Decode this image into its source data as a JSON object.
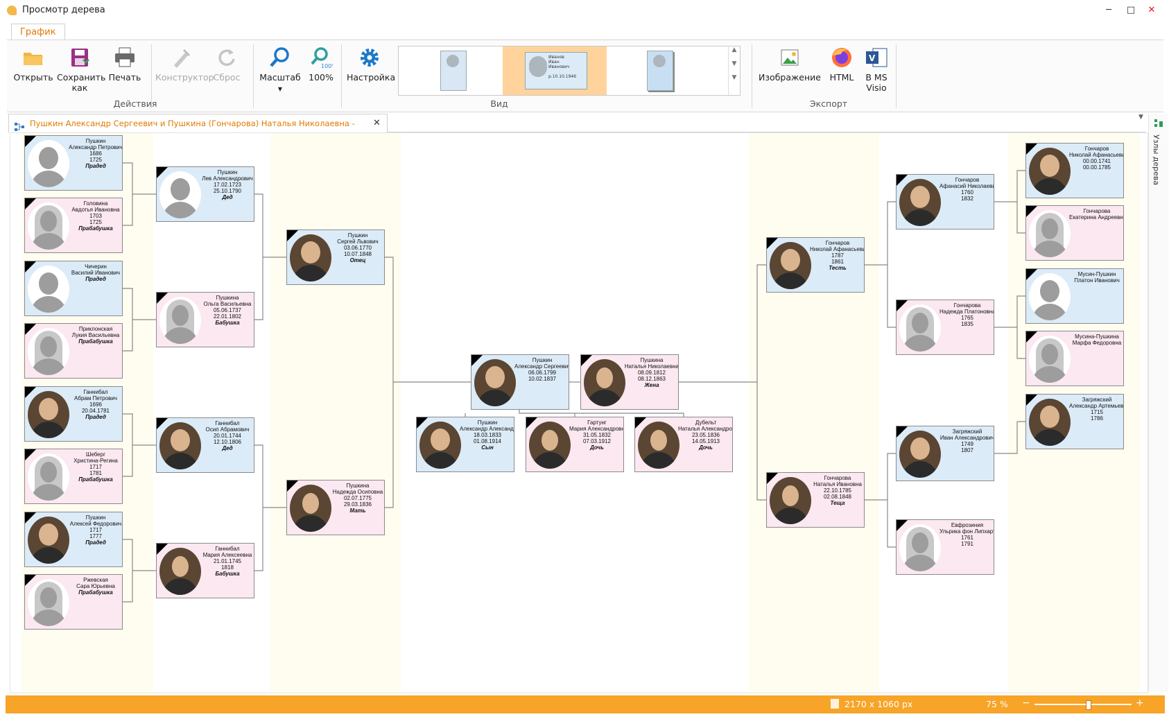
{
  "window": {
    "title": "Просмотр дерева",
    "minimize": "─",
    "maximize": "□",
    "close": "✕",
    "close_color": "#e81123"
  },
  "ribbon_tab": "График",
  "ribbon": {
    "actions": {
      "label": "Действия",
      "open": "Открыть",
      "save_as_1": "Сохранить",
      "save_as_2": "как",
      "print": "Печать",
      "constructor": "Конструктор",
      "reset": "Сброс"
    },
    "view": {
      "label": "Вид",
      "zoom": "Масштаб",
      "zoom100": "100%",
      "settings": "Настройка"
    },
    "export": {
      "label": "Экспорт",
      "image": "Изображение",
      "html": "HTML",
      "visio_1": "В MS",
      "visio_2": "Visio"
    }
  },
  "gallery_sample": {
    "line1": "Иванов",
    "line2": "Иван",
    "line3": "Иванович",
    "line4": "р.10.10.1946"
  },
  "document_tab": {
    "title": "Пушкин Александр Сергеевич и Пушкина (Гончарова) Наталья Николаевна - График \"бабочка\"",
    "close": "✕"
  },
  "side_panel": {
    "label": "Узлы дерева"
  },
  "status": {
    "page_size": "2170 x 1060 px",
    "zoom": "75 %",
    "zoom_fraction": 0.55
  },
  "colors": {
    "male": "#dcebf8",
    "female": "#fbe8f0",
    "accent": "#f7a428",
    "band": "#fffdf0"
  },
  "nodes": [
    {
      "id": "n1",
      "g": "m",
      "lines": [
        "Пушкин",
        "Александр Петрович",
        "1686",
        "1725"
      ],
      "rel": "Прадед"
    },
    {
      "id": "n2",
      "g": "f",
      "lines": [
        "Головина",
        "Авдотья Ивановна",
        "1703",
        "1725"
      ],
      "rel": "Прабабушка"
    },
    {
      "id": "n3",
      "g": "m",
      "lines": [
        "Чичерин",
        "Василий Иванович"
      ],
      "rel": "Прадед"
    },
    {
      "id": "n4",
      "g": "f",
      "lines": [
        "Приклонская",
        "Лукия Васильевна"
      ],
      "rel": "Прабабушка"
    },
    {
      "id": "n5",
      "g": "m",
      "lines": [
        "Ганнибал",
        "Абрам Петрович",
        "1696",
        "20.04.1781"
      ],
      "rel": "Прадед",
      "portrait": true
    },
    {
      "id": "n6",
      "g": "f",
      "lines": [
        "Шеберг",
        "Христина-Регина",
        "1717",
        "1781"
      ],
      "rel": "Прабабушка"
    },
    {
      "id": "n7",
      "g": "m",
      "lines": [
        "Пушкин",
        "Алексей Федорович",
        "1717",
        "1777"
      ],
      "rel": "Прадед",
      "portrait": true
    },
    {
      "id": "n8",
      "g": "f",
      "lines": [
        "Ржевская",
        "Сара Юрьевна"
      ],
      "rel": "Прабабушка"
    },
    {
      "id": "n9",
      "g": "m",
      "lines": [
        "Пушкин",
        "Лев Александрович",
        "17.02.1723",
        "25.10.1790"
      ],
      "rel": "Дед"
    },
    {
      "id": "n10",
      "g": "f",
      "lines": [
        "Пушкина",
        "Ольга Васильевна",
        "05.06.1737",
        "22.01.1802"
      ],
      "rel": "Бабушка"
    },
    {
      "id": "n11",
      "g": "m",
      "lines": [
        "Ганнибал",
        "Осип Абрамович",
        "20.01.1744",
        "12.10.1806"
      ],
      "rel": "Дед",
      "portrait": true
    },
    {
      "id": "n12",
      "g": "f",
      "lines": [
        "Ганнибал",
        "Мария Алексеевна",
        "21.01.1745",
        "1818"
      ],
      "rel": "Бабушка",
      "portrait": true
    },
    {
      "id": "n13",
      "g": "m",
      "lines": [
        "Пушкин",
        "Сергей Львович",
        "03.06.1770",
        "10.07.1848"
      ],
      "rel": "Отец",
      "portrait": true
    },
    {
      "id": "n14",
      "g": "f",
      "lines": [
        "Пушкина",
        "Надежда Осиповна",
        "02.07.1775",
        "29.03.1836"
      ],
      "rel": "Мать",
      "portrait": true
    },
    {
      "id": "n15",
      "g": "m",
      "lines": [
        "Пушкин",
        "Александр Сергеевич",
        "06.06.1799",
        "10.02.1837"
      ],
      "rel": "",
      "portrait": true
    },
    {
      "id": "n16",
      "g": "f",
      "lines": [
        "Пушкина",
        "Наталья Николаевна",
        "08.09.1812",
        "08.12.1863"
      ],
      "rel": "Жена",
      "portrait": true
    },
    {
      "id": "n17",
      "g": "m",
      "lines": [
        "Пушкин",
        "Александр Александрович",
        "18.03.1833",
        "01.08.1914"
      ],
      "rel": "Сын",
      "portrait": true
    },
    {
      "id": "n18",
      "g": "f",
      "lines": [
        "Гартунг",
        "Мария Александровна",
        "31.05.1832",
        "07.03.1912"
      ],
      "rel": "Дочь",
      "portrait": true
    },
    {
      "id": "n19",
      "g": "f",
      "lines": [
        "Дубельт",
        "Наталья Александровна",
        "23.05.1836",
        "14.05.1913"
      ],
      "rel": "Дочь",
      "portrait": true
    },
    {
      "id": "n20",
      "g": "m",
      "lines": [
        "Гончаров",
        "Николай Афанасьевич",
        "1787",
        "1861"
      ],
      "rel": "Тесть",
      "portrait": true
    },
    {
      "id": "n21",
      "g": "f",
      "lines": [
        "Гончарова",
        "Наталья Ивановна",
        "22.10.1785",
        "02.08.1848"
      ],
      "rel": "Теща",
      "portrait": true
    },
    {
      "id": "n22",
      "g": "m",
      "lines": [
        "Гончаров",
        "Афанасий Николаевич",
        "1760",
        "1832"
      ],
      "rel": "",
      "portrait": true
    },
    {
      "id": "n23",
      "g": "f",
      "lines": [
        "Гончарова",
        "Надежда Платоновна",
        "1765",
        "1835"
      ],
      "rel": ""
    },
    {
      "id": "n24",
      "g": "m",
      "lines": [
        "Загряжский",
        "Иван Александрович",
        "1749",
        "1807"
      ],
      "rel": "",
      "portrait": true
    },
    {
      "id": "n25",
      "g": "f",
      "lines": [
        "Евфрозиния",
        "Ульрика фон Липхарт",
        "1761",
        "1791"
      ],
      "rel": ""
    },
    {
      "id": "n26",
      "g": "m",
      "lines": [
        "Гончаров",
        "Николай Афанасьевич",
        "00.00.1741",
        "00.00.1785"
      ],
      "rel": "",
      "portrait": true
    },
    {
      "id": "n27",
      "g": "f",
      "lines": [
        "Гончарова",
        "Екатерина Андреевна"
      ],
      "rel": ""
    },
    {
      "id": "n28",
      "g": "m",
      "lines": [
        "Мусин-Пушкин",
        "Платон Иванович"
      ],
      "rel": ""
    },
    {
      "id": "n29",
      "g": "f",
      "lines": [
        "Мусина-Пушкина",
        "Марфа Федоровна"
      ],
      "rel": ""
    },
    {
      "id": "n30",
      "g": "m",
      "lines": [
        "Загряжский",
        "Александр Артемьевич",
        "1715",
        "1786"
      ],
      "rel": "",
      "portrait": true
    }
  ]
}
